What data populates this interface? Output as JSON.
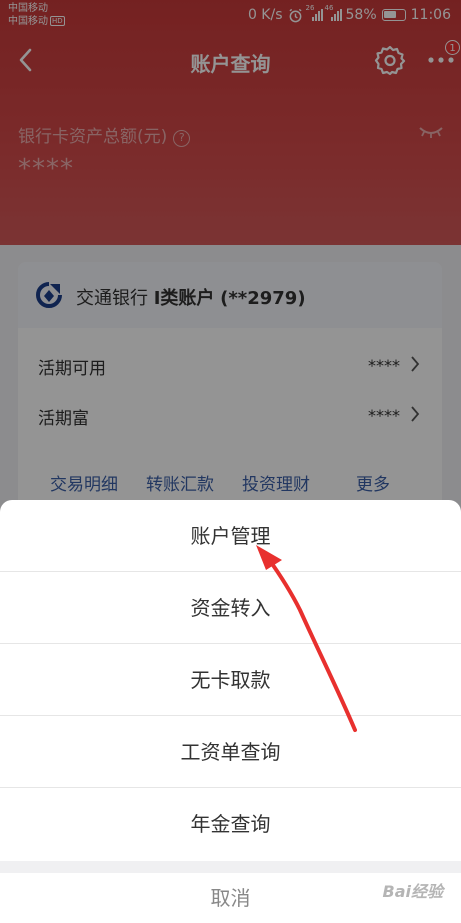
{
  "status_bar": {
    "carrier1": "中国移动",
    "carrier2": "中国移动",
    "carrier2_badge": "HD",
    "net_speed": "0 K/s",
    "sig1_label": "26",
    "sig2_label": "46",
    "battery": "58%",
    "time": "11:06"
  },
  "navbar": {
    "title": "账户查询",
    "badge_count": "1"
  },
  "asset": {
    "label": "银行卡资产总额(元)",
    "help": "?",
    "value": "****"
  },
  "card": {
    "bank": "交通银行",
    "account_type": "I类账户",
    "account_no": "(**2979)",
    "rows": [
      {
        "label": "活期可用",
        "value": "****"
      },
      {
        "label": "活期富",
        "value": "****"
      }
    ],
    "links": [
      "交易明细",
      "转账汇款",
      "投资理财",
      "更多"
    ]
  },
  "sheet": {
    "items": [
      "账户管理",
      "资金转入",
      "无卡取款",
      "工资单查询",
      "年金查询"
    ],
    "cancel": "取消"
  },
  "watermark": "Bai经验",
  "colors": {
    "header_red": "#c93a3a",
    "link_blue": "#3b5fa8",
    "arrow_red": "#e8302e"
  }
}
